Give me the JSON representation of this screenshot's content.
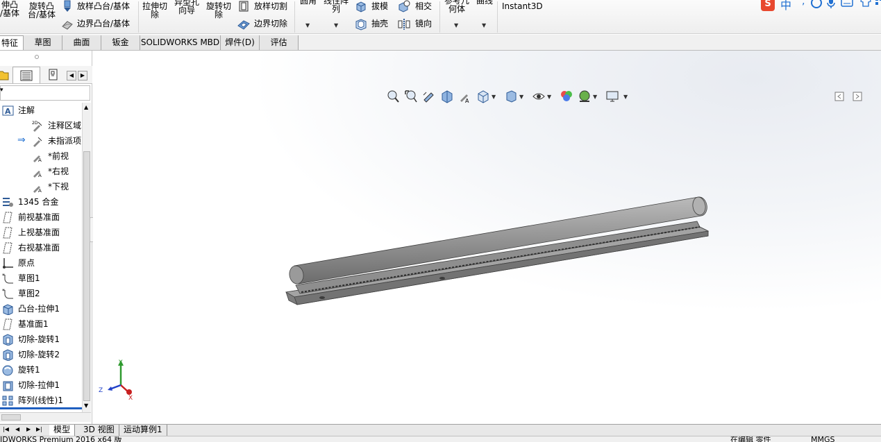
{
  "ribbon": {
    "extrude_boss": "伸凸\n/基体",
    "revolve_boss": "旋转凸\n台/基体",
    "loft_boss": "放样凸台/基体",
    "boundary_boss": "边界凸台/基体",
    "extrude_cut": "拉伸切\n除",
    "hole_wizard": "异型孔\n向导",
    "revolve_cut": "旋转切\n除",
    "loft_cut": "放样切割",
    "boundary_cut": "边界切除",
    "fillet": "圆角",
    "linear_pattern": "线性阵\n列",
    "draft": "拔模",
    "shell": "抽壳",
    "intersect": "相交",
    "mirror": "镜向",
    "ref_geometry": "参考几\n何体",
    "curves": "曲线",
    "instant3d": "Instant3D"
  },
  "tabs": [
    "特征",
    "草图",
    "曲面",
    "钣金",
    "SOLIDWORKS MBD",
    "焊件(D)",
    "评估"
  ],
  "tree": {
    "annotations": "注解",
    "annotation_area": "注释区域",
    "unassigned": "未指派项",
    "front_view": "*前视",
    "right_view": "*右视",
    "bottom_view": "*下视",
    "material": "1345 合金",
    "front_plane": "前视基准面",
    "top_plane": "上视基准面",
    "right_plane": "右视基准面",
    "origin": "原点",
    "sketch1": "草图1",
    "sketch2": "草图2",
    "boss_extrude1": "凸台-拉伸1",
    "plane1": "基准面1",
    "cut_revolve1": "切除-旋转1",
    "cut_revolve2": "切除-旋转2",
    "revolve1": "旋转1",
    "cut_extrude1": "切除-拉伸1",
    "linear_pattern1": "阵列(线性)1"
  },
  "axes": {
    "x": "X",
    "y": "Y",
    "z": "Z"
  },
  "bottom_tabs": [
    "模型",
    "3D 视图",
    "运动算例1"
  ],
  "status": {
    "app": "IDWORKS Premium 2016 x64 版",
    "editing": "在编辑 零件",
    "units": "MMGS"
  },
  "ime": {
    "lang": "中"
  },
  "colors": {
    "accent": "#1f6fd1",
    "part": "#8a8a8a",
    "logo": "#e8482e"
  }
}
